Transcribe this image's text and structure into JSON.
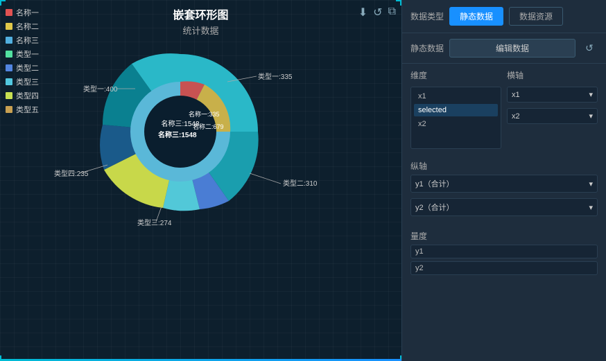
{
  "chart": {
    "title": "嵌套环形图",
    "subtitle": "统计数据",
    "toolbar": {
      "download_icon": "⬇",
      "refresh_icon": "↺",
      "copy_icon": "⧉"
    },
    "legend": [
      {
        "label": "名称一",
        "color": "#e05252"
      },
      {
        "label": "名称二",
        "color": "#e0c84a"
      },
      {
        "label": "名称三",
        "color": "#52b0e0"
      },
      {
        "label": "类型一",
        "color": "#52e0a0"
      },
      {
        "label": "类型二",
        "color": "#5285e0"
      },
      {
        "label": "类型三",
        "color": "#52c8e0"
      },
      {
        "label": "类型四",
        "color": "#c8e052"
      },
      {
        "label": "类型五",
        "color": "#c8a052"
      }
    ],
    "labels": [
      {
        "text": "类型一:400",
        "x": "110",
        "y": "75"
      },
      {
        "text": "类型一:335",
        "x": "345",
        "y": "68"
      },
      {
        "text": "名称一:335",
        "x": "225",
        "y": "145"
      },
      {
        "text": "名称二:679",
        "x": "255",
        "y": "165"
      },
      {
        "text": "名称三:1548",
        "x": "215",
        "y": "210"
      },
      {
        "text": "类型二:310",
        "x": "390",
        "y": "240"
      },
      {
        "text": "类型四:235",
        "x": "95",
        "y": "255"
      },
      {
        "text": "类型三:274",
        "x": "185",
        "y": "320"
      }
    ]
  },
  "right_panel": {
    "data_type_label": "数据类型",
    "tabs": [
      {
        "label": "静态数据",
        "active": true
      },
      {
        "label": "数据资源",
        "active": false
      }
    ],
    "static_data_label": "静态数据",
    "edit_data_btn": "编辑数据",
    "refresh_icon": "↺",
    "dimension_label": "维度",
    "axis_label": "横轴",
    "dimension_items": [
      {
        "label": "x1",
        "selected": false
      },
      {
        "label": "selected",
        "selected": true
      },
      {
        "label": "x2",
        "selected": false
      }
    ],
    "axis_items": [
      {
        "label": "x1"
      },
      {
        "label": "x2"
      }
    ],
    "y_axis_label": "纵轴",
    "y_axis_items": [
      {
        "label": "y1（合计）"
      },
      {
        "label": "y2（合计）"
      }
    ],
    "measure_label": "量度",
    "measure_items": [
      {
        "label": "y1"
      },
      {
        "label": "y2"
      }
    ]
  }
}
